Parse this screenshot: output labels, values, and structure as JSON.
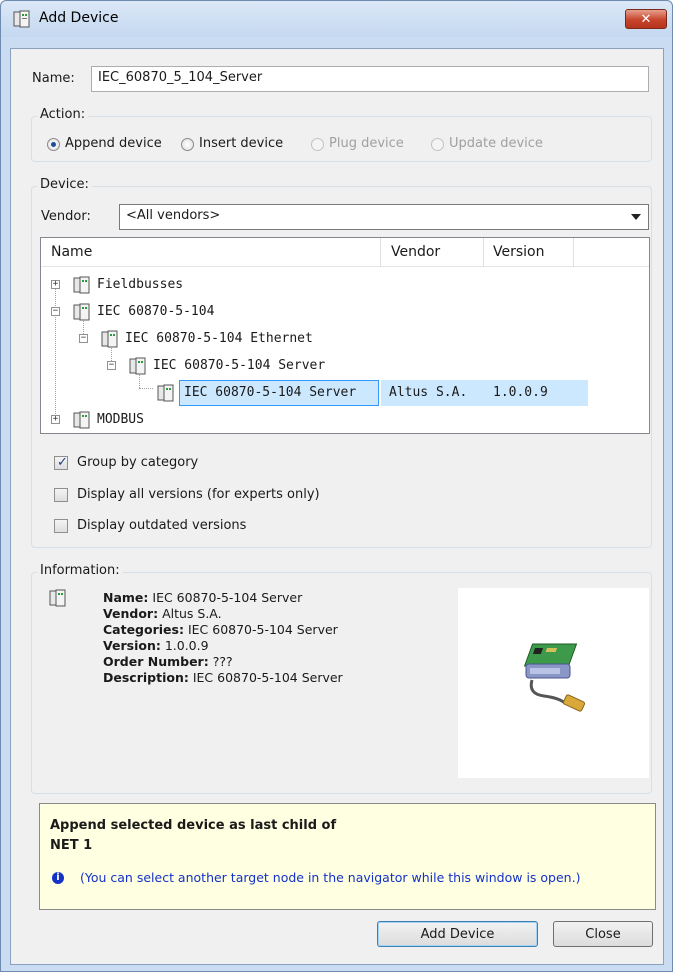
{
  "window": {
    "title": "Add Device",
    "close_glyph": "✕"
  },
  "name_field": {
    "label": "Name:",
    "value": "IEC_60870_5_104_Server"
  },
  "action": {
    "title": "Action:",
    "options": [
      {
        "label": "Append device",
        "selected": true,
        "enabled": true
      },
      {
        "label": "Insert device",
        "selected": false,
        "enabled": true
      },
      {
        "label": "Plug device",
        "selected": false,
        "enabled": false
      },
      {
        "label": "Update device",
        "selected": false,
        "enabled": false
      }
    ]
  },
  "device": {
    "title": "Device:",
    "vendor_label": "Vendor:",
    "vendor_value": "<All vendors>",
    "columns": [
      "Name",
      "Vendor",
      "Version"
    ],
    "tree": [
      {
        "label": "Fieldbusses",
        "expander": "+"
      },
      {
        "label": "IEC 60870-5-104",
        "expander": "−"
      },
      {
        "label": "IEC 60870-5-104 Ethernet",
        "expander": "−"
      },
      {
        "label": "IEC 60870-5-104 Server",
        "expander": "−"
      },
      {
        "label": "IEC 60870-5-104 Server",
        "vendor": "Altus S.A.",
        "version": "1.0.0.9",
        "selected": true
      },
      {
        "label": "MODBUS",
        "expander": "+"
      }
    ],
    "checkboxes": [
      {
        "label": "Group by category",
        "checked": true
      },
      {
        "label": "Display all versions (for experts only)",
        "checked": false
      },
      {
        "label": "Display outdated versions",
        "checked": false
      }
    ]
  },
  "information": {
    "title": "Information:",
    "fields": [
      {
        "key": "Name:",
        "value": "IEC 60870-5-104 Server"
      },
      {
        "key": "Vendor:",
        "value": "Altus S.A."
      },
      {
        "key": "Categories:",
        "value": "IEC 60870-5-104 Server"
      },
      {
        "key": "Version:",
        "value": "1.0.0.9"
      },
      {
        "key": "Order Number:",
        "value": "???"
      },
      {
        "key": "Description:",
        "value": "IEC 60870-5-104 Server"
      }
    ]
  },
  "hint": {
    "line1": "Append selected device as last child of",
    "line2": "NET 1",
    "info_icon": "i",
    "note": "(You can select another target node in the navigator while this window is open.)"
  },
  "buttons": {
    "add": "Add Device",
    "close": "Close"
  },
  "colors": {
    "frame": "#c9dcf2",
    "selection": "#cce8ff",
    "hint_background": "#ffffe1",
    "info_icon_blue": "#1432c8"
  }
}
